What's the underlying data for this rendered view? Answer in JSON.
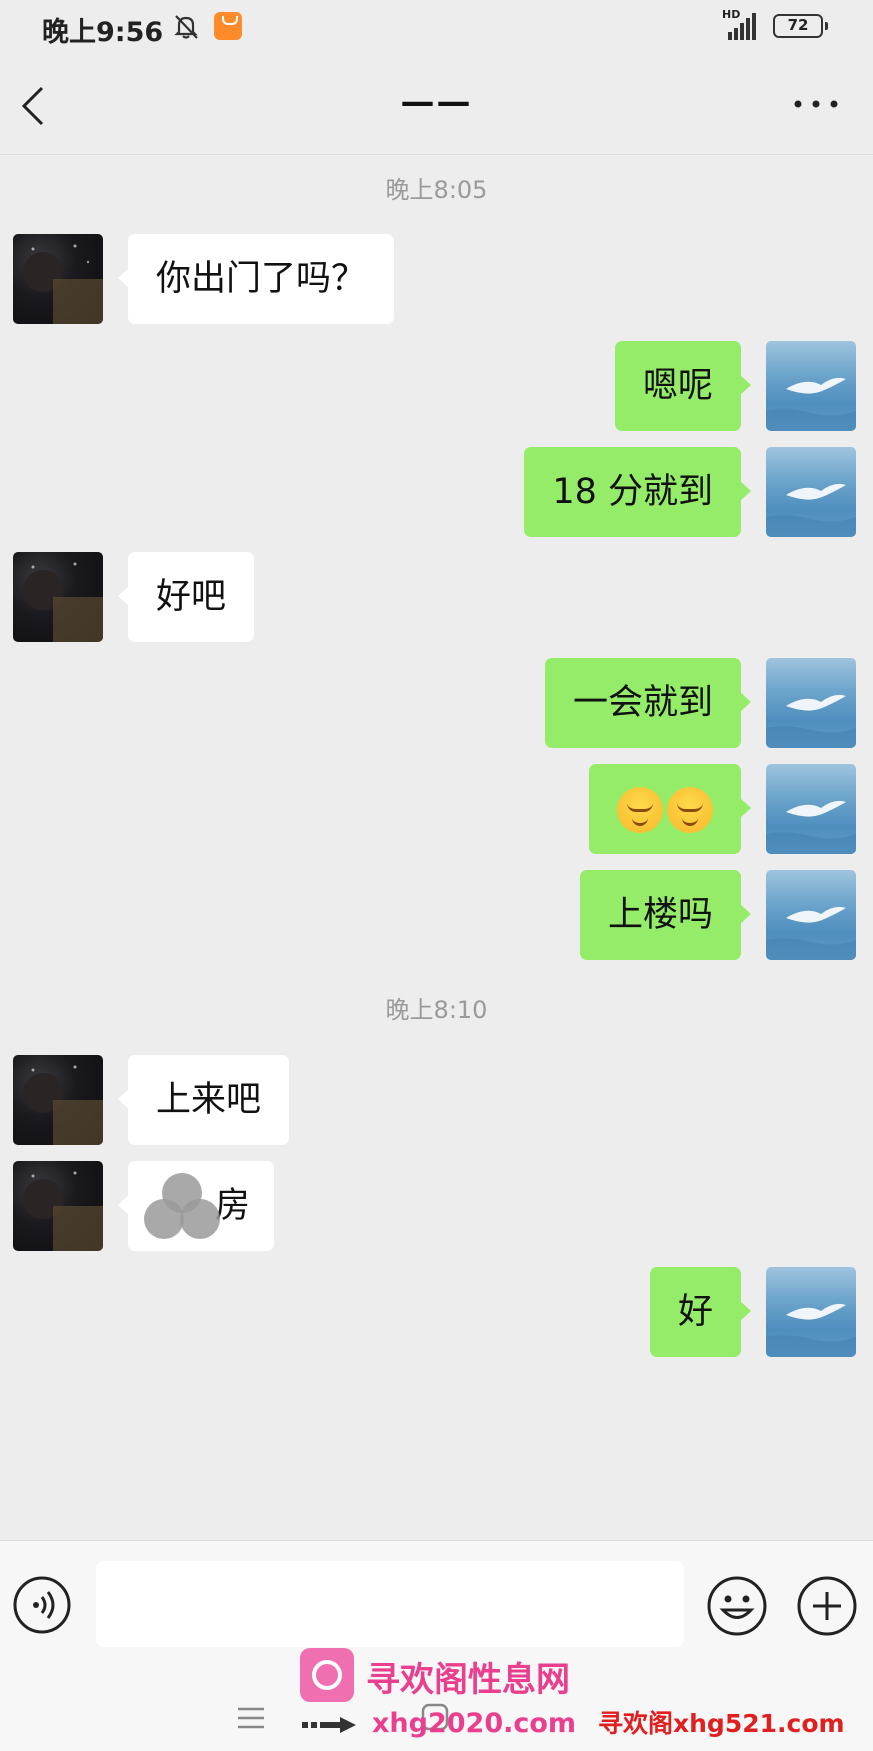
{
  "status_bar": {
    "time": "晚上9:56",
    "network": "HD",
    "battery": "72"
  },
  "header": {
    "title": "——"
  },
  "chat": {
    "items": [
      {
        "kind": "timestamp",
        "text": "晚上8:05"
      },
      {
        "kind": "message",
        "sender": "contact",
        "text": "你出门了吗？"
      },
      {
        "kind": "message",
        "sender": "me",
        "text": "嗯呢"
      },
      {
        "kind": "message",
        "sender": "me",
        "text": "18 分就到"
      },
      {
        "kind": "message",
        "sender": "contact",
        "text": "好吧"
      },
      {
        "kind": "message",
        "sender": "me",
        "text": "一会就到"
      },
      {
        "kind": "message",
        "sender": "me",
        "emoji": [
          "relieved-face",
          "relieved-face"
        ]
      },
      {
        "kind": "message",
        "sender": "me",
        "text": "上楼吗"
      },
      {
        "kind": "timestamp",
        "text": "晚上8:10"
      },
      {
        "kind": "message",
        "sender": "contact",
        "text": "上来吧"
      },
      {
        "kind": "message",
        "sender": "contact",
        "text": "房",
        "redacted": true
      },
      {
        "kind": "message",
        "sender": "me",
        "text": "好"
      }
    ]
  },
  "input_bar": {
    "placeholder": "",
    "icons": [
      "voice-icon",
      "emoji-icon",
      "plus-icon"
    ]
  },
  "colors": {
    "background": "#ededed",
    "outgoing_bubble": "#95ec69",
    "incoming_bubble": "#ffffff",
    "timestamp": "#9a9a9a"
  },
  "watermark": {
    "text_1": "寻欢阁性息网",
    "text_2": "xhg2020.com",
    "text_3": "寻欢阁xhg521.com"
  }
}
